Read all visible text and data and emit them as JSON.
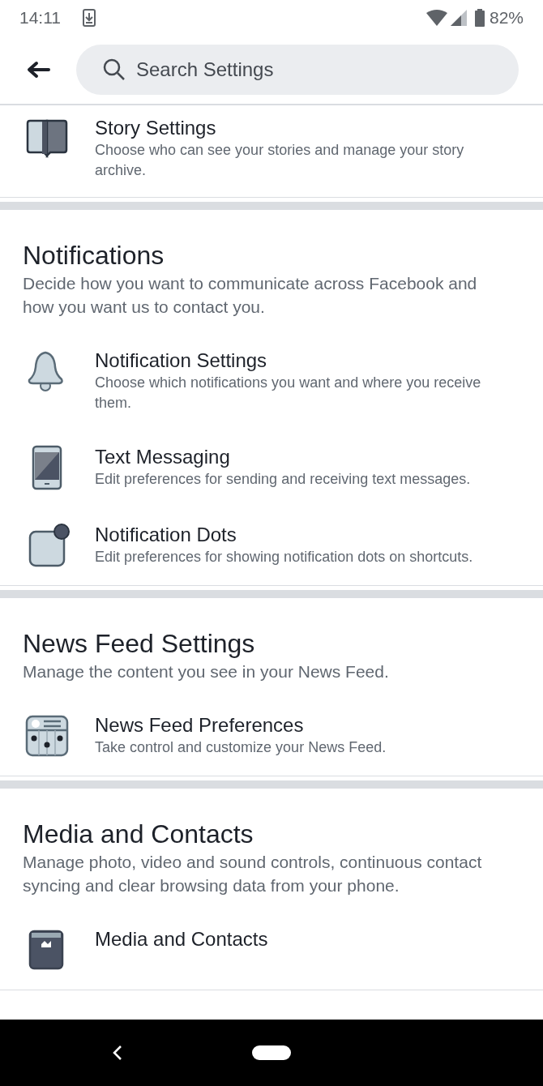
{
  "status_bar": {
    "time": "14:11",
    "battery": "82%"
  },
  "search": {
    "placeholder": "Search Settings"
  },
  "top_items": [
    {
      "kind": "book",
      "title": "Story Settings",
      "description": "Choose who can see your stories and manage your story archive."
    }
  ],
  "sections": [
    {
      "heading": "Notifications",
      "description": "Decide how you want to communicate across Facebook and how you want us to contact you.",
      "items": [
        {
          "kind": "bell",
          "title": "Notification Settings",
          "description": "Choose which notifications you want and where you receive them."
        },
        {
          "kind": "phone",
          "title": "Text Messaging",
          "description": "Edit preferences for sending and receiving text messages."
        },
        {
          "kind": "dot",
          "title": "Notification Dots",
          "description": "Edit preferences for showing notification dots on shortcuts."
        }
      ]
    },
    {
      "heading": "News Feed Settings",
      "description": "Manage the content you see in your News Feed.",
      "items": [
        {
          "kind": "feed",
          "title": "News Feed Preferences",
          "description": "Take control and customize your News Feed."
        }
      ]
    },
    {
      "heading": "Media and Contacts",
      "description": "Manage photo, video and sound controls, continuous contact syncing and clear browsing data from your phone.",
      "items": [
        {
          "kind": "media",
          "title": "Media and Contacts"
        }
      ]
    }
  ]
}
